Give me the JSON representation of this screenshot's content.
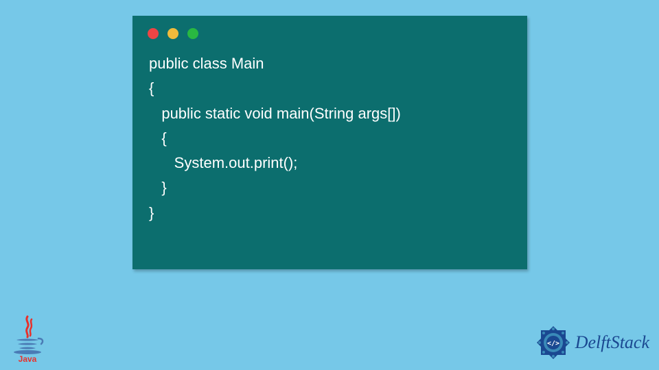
{
  "window": {
    "traffic_lights": {
      "red": "#ec4545",
      "yellow": "#f0bb3c",
      "green": "#29b841"
    }
  },
  "code": {
    "lines": [
      "public class Main",
      "{",
      "   public static void main(String args[])",
      "   {",
      "      System.out.print();",
      "   }",
      "}"
    ]
  },
  "branding": {
    "java_label": "Java",
    "delft_label": "DelftStack"
  },
  "colors": {
    "background": "#76c8e8",
    "window_bg": "#0c6e6e",
    "code_text": "#ffffff",
    "delft_blue": "#1a4891"
  }
}
